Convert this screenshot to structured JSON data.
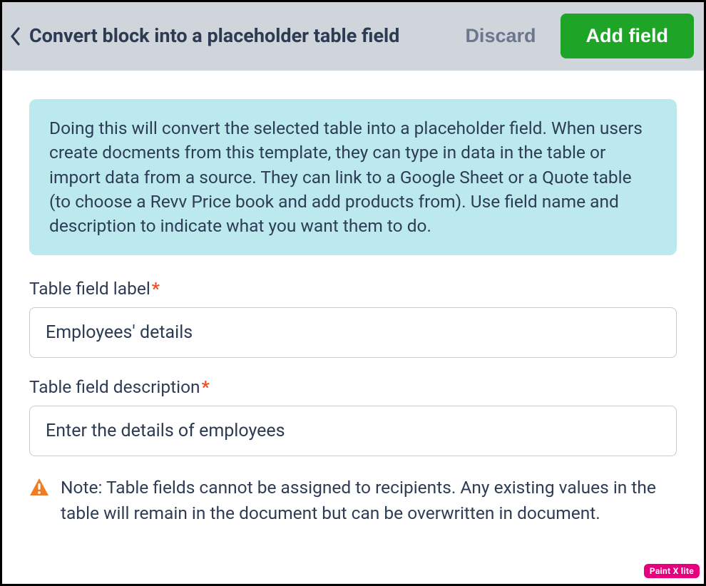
{
  "header": {
    "title": "Convert block into a placeholder table field",
    "discard_label": "Discard",
    "add_label": "Add field"
  },
  "info_text": "Doing this will convert the selected table into a placeholder field. When users create docments from this template, they can type in data in the table or import data from a source. They can link to a Google Sheet or a Quote table (to choose a Revv Price book and add products from). Use field name and description to indicate what you want them to do.",
  "fields": {
    "label_field": {
      "label": "Table field label",
      "value": "Employees' details"
    },
    "description_field": {
      "label": "Table field description",
      "value": "Enter the details of employees"
    }
  },
  "note_text": "Note: Table fields cannot be assigned to recipients. Any existing values in the table will remain in the document but can be overwritten in document.",
  "watermark": "Paint X lite",
  "required_star": "*"
}
